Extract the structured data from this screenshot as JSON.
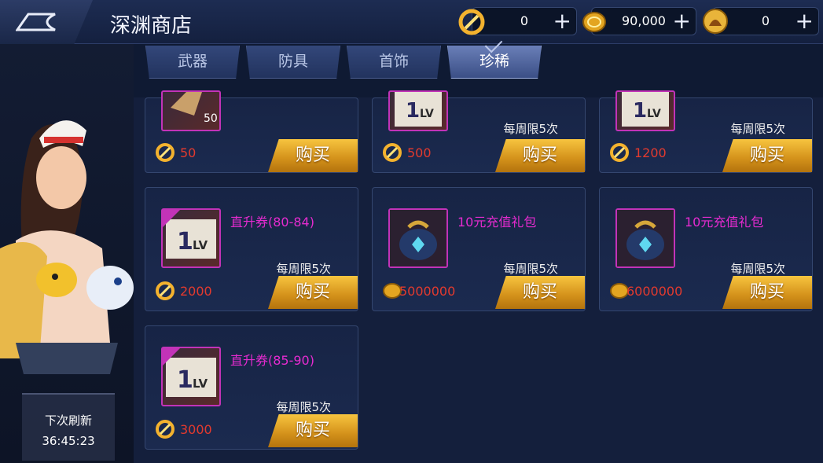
{
  "header": {
    "title": "深渊商店"
  },
  "currencies": [
    {
      "icon": "abyss-token-icon",
      "value": "0",
      "add": "+"
    },
    {
      "icon": "gold-coin-icon",
      "value": "90,000",
      "add": "+"
    },
    {
      "icon": "honor-medal-icon",
      "value": "0",
      "add": "+"
    }
  ],
  "tabs": [
    {
      "label": "武器"
    },
    {
      "label": "防具"
    },
    {
      "label": "首饰"
    },
    {
      "label": "珍稀"
    }
  ],
  "active_tab": "珍稀",
  "items": [
    {
      "name": "",
      "limit": "",
      "price": "50",
      "currency_icon": "abyss-token-icon",
      "qty": "50",
      "buy": "购买"
    },
    {
      "name": "",
      "limit": "每周限5次",
      "price": "500",
      "currency_icon": "abyss-token-icon",
      "buy": "购买"
    },
    {
      "name": "",
      "limit": "每周限5次",
      "price": "1200",
      "currency_icon": "abyss-token-icon",
      "buy": "购买"
    },
    {
      "name": "直升券(80-84)",
      "limit": "每周限5次",
      "price": "2000",
      "currency_icon": "abyss-token-icon",
      "buy": "购买"
    },
    {
      "name": "10元充值礼包",
      "limit": "每周限5次",
      "price": "5000000",
      "currency_icon": "gold-coin-icon",
      "buy": "购买"
    },
    {
      "name": "10元充值礼包",
      "limit": "每周限5次",
      "price": "6000000",
      "currency_icon": "gold-coin-icon",
      "buy": "购买"
    },
    {
      "name": "直升券(85-90)",
      "limit": "每周限5次",
      "price": "3000",
      "currency_icon": "abyss-token-icon",
      "buy": "购买"
    }
  ],
  "refresh": {
    "label": "下次刷新",
    "time": "36:45:23"
  },
  "colors": {
    "item_name": "#e62bd0",
    "price": "#e33a2e",
    "buy_button": "#e8a526"
  }
}
